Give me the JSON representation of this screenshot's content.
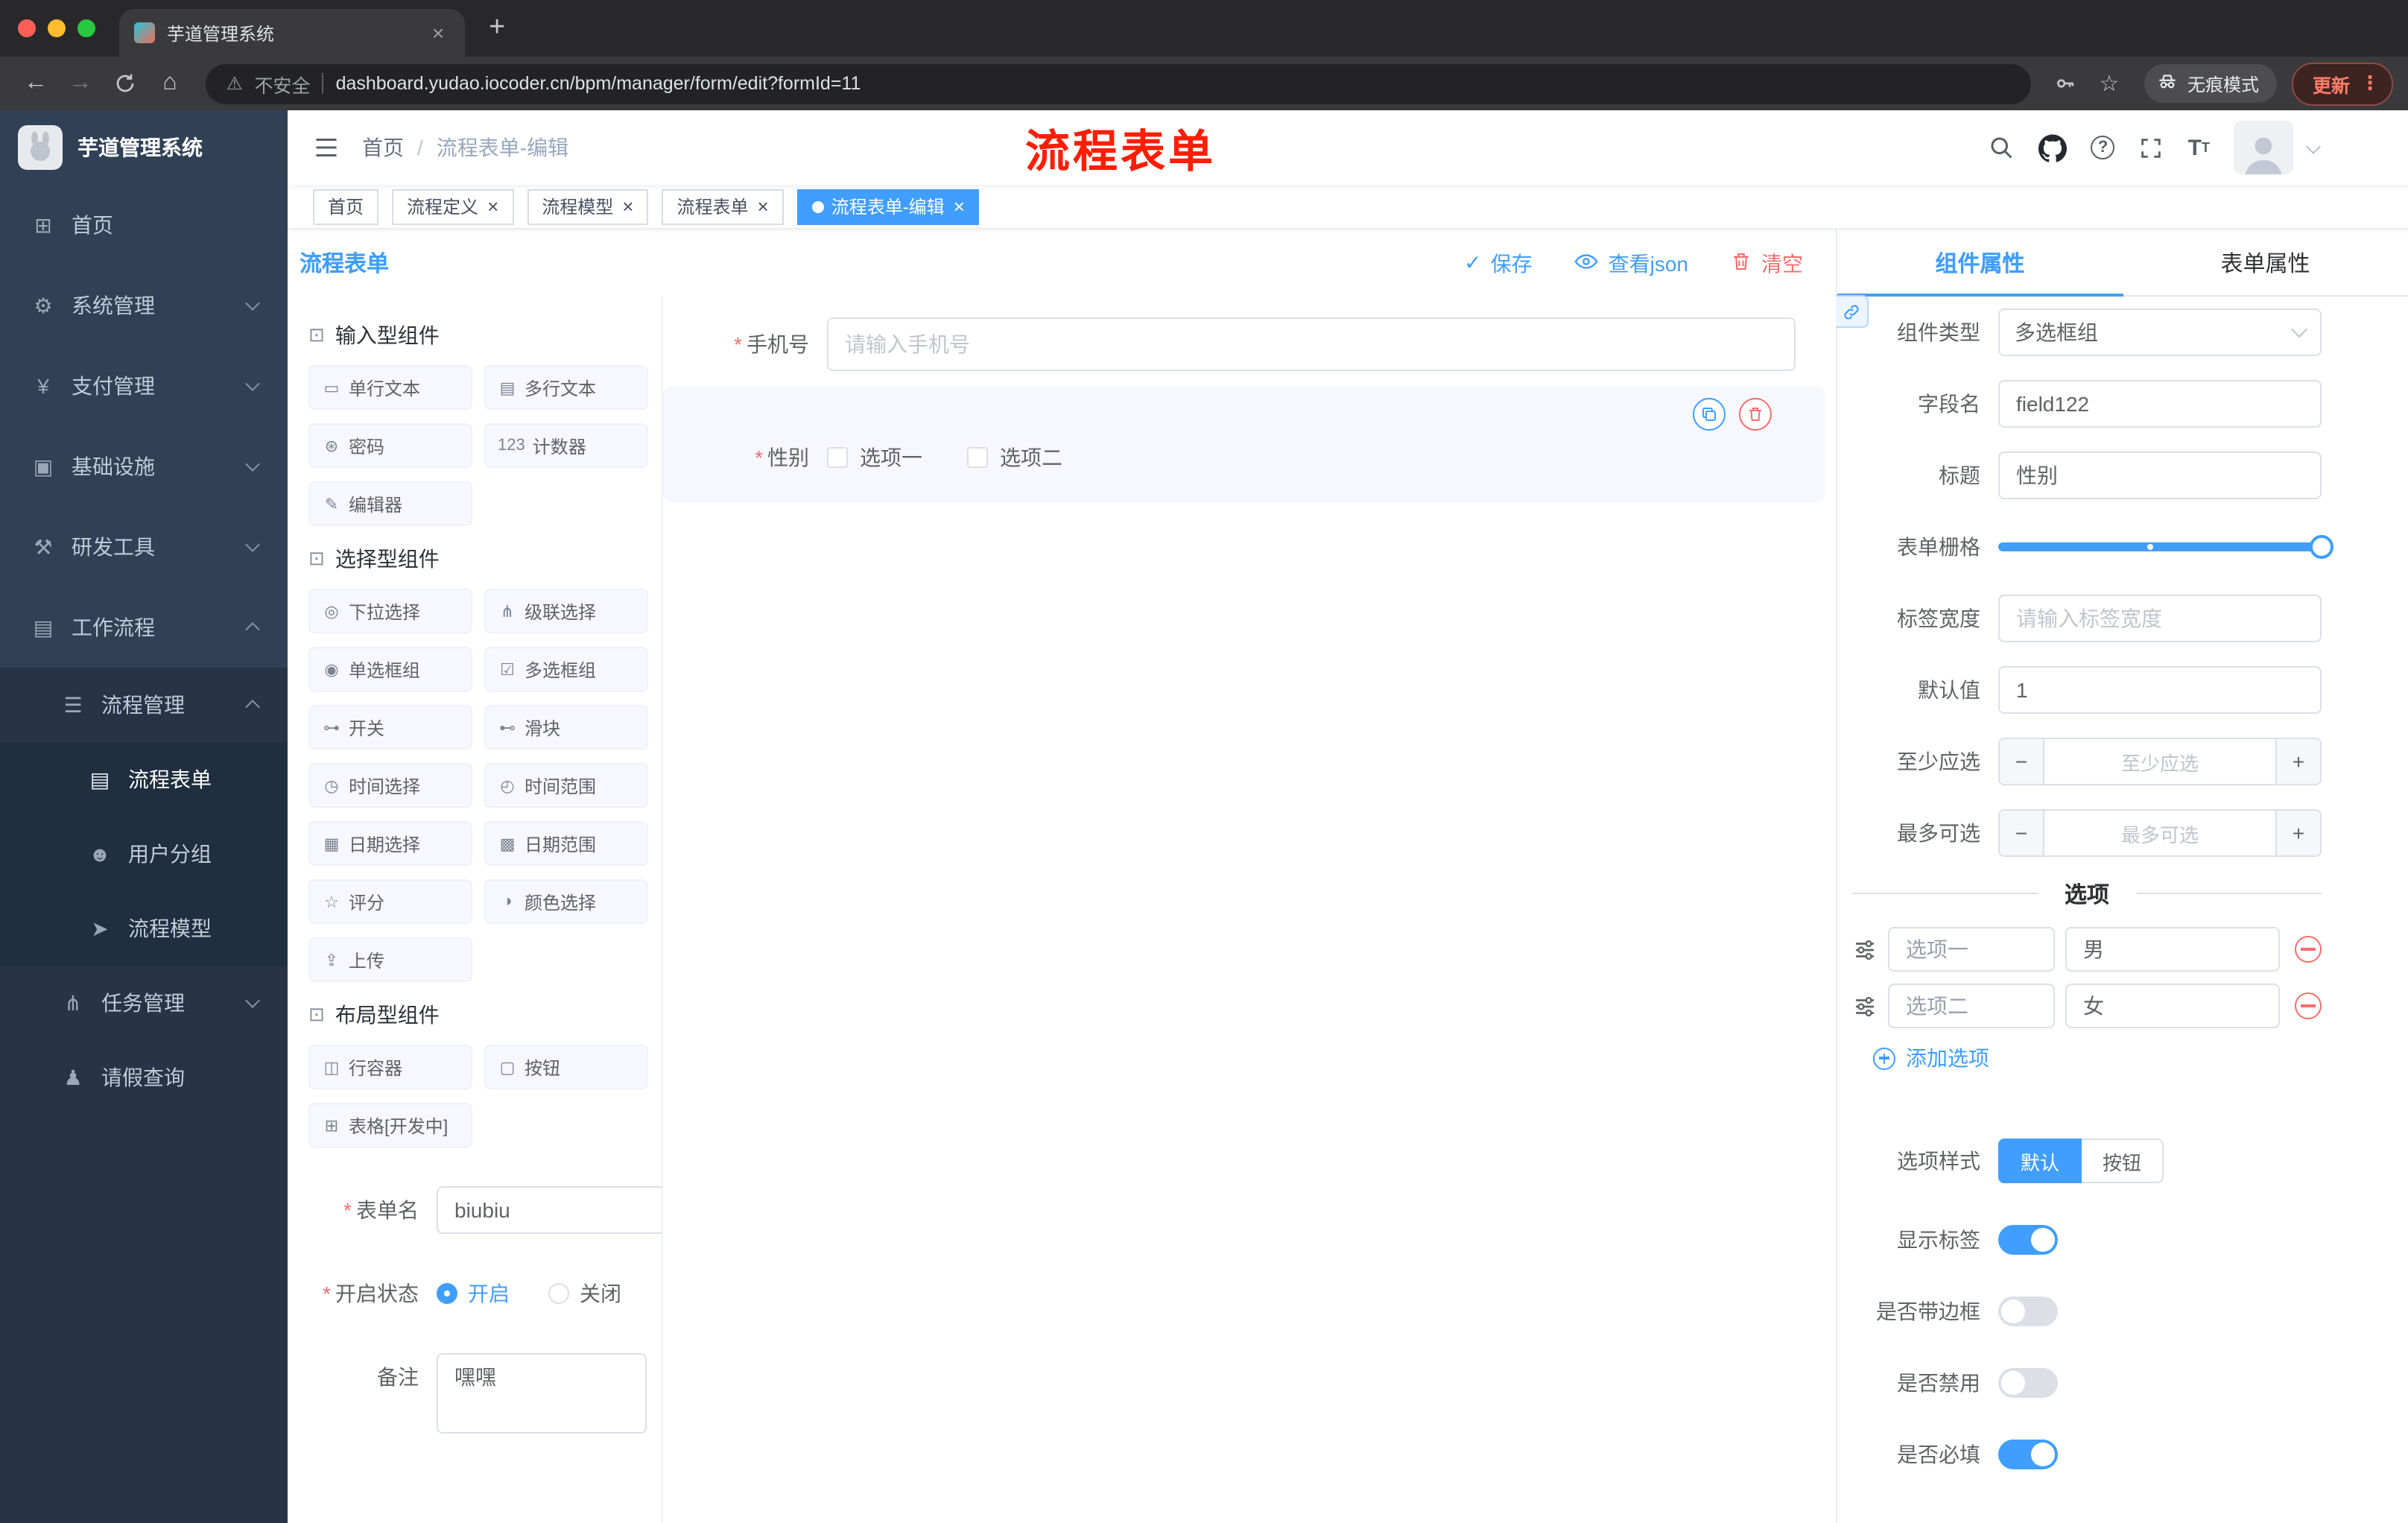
{
  "colors": {
    "accent": "#409eff",
    "danger": "#f56c6c",
    "annotation": "#ff1e00",
    "sidebar_bg": "#304156"
  },
  "ui": {
    "required_mark": "*",
    "close_glyph": "×",
    "plus_glyph": "+",
    "back_glyph": "←",
    "forward_glyph": "→",
    "home_glyph": "⌂",
    "warning_glyph": "⚠",
    "star_glyph": "☆",
    "kebab_glyph": "⋮",
    "check_glyph": "✓",
    "question_glyph": "?",
    "font_size_glyph": "T",
    "minus_glyph": "−"
  },
  "annotation": {
    "text": "流程表单"
  },
  "browser": {
    "tab_title": "芋道管理系统",
    "security_label": "不安全",
    "url": "dashboard.yudao.iocoder.cn/bpm/manager/form/edit?formId=11",
    "incognito_label": "无痕模式",
    "update_label": "更新"
  },
  "sidebar": {
    "logo_title": "芋道管理系统",
    "items": [
      {
        "label": "首页",
        "glyph": "⊞"
      },
      {
        "label": "系统管理",
        "glyph": "⚙"
      },
      {
        "label": "支付管理",
        "glyph": "¥"
      },
      {
        "label": "基础设施",
        "glyph": "▣"
      },
      {
        "label": "研发工具",
        "glyph": "⚒"
      },
      {
        "label": "工作流程",
        "glyph": "▤"
      }
    ],
    "workflow": {
      "process_mgmt": {
        "label": "流程管理",
        "glyph": "☰"
      },
      "children": [
        {
          "label": "流程表单",
          "glyph": "▤"
        },
        {
          "label": "用户分组",
          "glyph": "☻"
        },
        {
          "label": "流程模型",
          "glyph": "➤"
        }
      ],
      "task_mgmt": {
        "label": "任务管理",
        "glyph": "⋔"
      },
      "leave_query": {
        "label": "请假查询",
        "glyph": "♟"
      }
    }
  },
  "navbar": {
    "breadcrumb_home": "首页",
    "breadcrumb_sep": "/",
    "breadcrumb_current": "流程表单-编辑"
  },
  "tags": [
    {
      "label": "首页"
    },
    {
      "label": "流程定义"
    },
    {
      "label": "流程模型"
    },
    {
      "label": "流程表单"
    },
    {
      "label": "流程表单-编辑"
    }
  ],
  "designer": {
    "title": "流程表单",
    "save": "保存",
    "view_json": "查看json",
    "clear": "清空",
    "groups": [
      {
        "title": "输入型组件",
        "glyph": "⊡",
        "items": [
          {
            "label": "单行文本",
            "glyph": "▭"
          },
          {
            "label": "多行文本",
            "glyph": "▤"
          },
          {
            "label": "密码",
            "glyph": "⊛"
          },
          {
            "label": "计数器",
            "glyph": "123"
          },
          {
            "label": "编辑器",
            "glyph": "✎"
          }
        ]
      },
      {
        "title": "选择型组件",
        "glyph": "⊡",
        "items": [
          {
            "label": "下拉选择",
            "glyph": "◎"
          },
          {
            "label": "级联选择",
            "glyph": "⋔"
          },
          {
            "label": "单选框组",
            "glyph": "◉"
          },
          {
            "label": "多选框组",
            "glyph": "☑"
          },
          {
            "label": "开关",
            "glyph": "⊶"
          },
          {
            "label": "滑块",
            "glyph": "⊷"
          },
          {
            "label": "时间选择",
            "glyph": "◷"
          },
          {
            "label": "时间范围",
            "glyph": "◴"
          },
          {
            "label": "日期选择",
            "glyph": "▦"
          },
          {
            "label": "日期范围",
            "glyph": "▩"
          },
          {
            "label": "评分",
            "glyph": "☆"
          },
          {
            "label": "颜色选择",
            "glyph": "◑"
          },
          {
            "label": "上传",
            "glyph": "⇪"
          }
        ]
      },
      {
        "title": "布局型组件",
        "glyph": "⊡",
        "items": [
          {
            "label": "行容器",
            "glyph": "◫"
          },
          {
            "label": "按钮",
            "glyph": "▢"
          },
          {
            "label": "表格[开发中]",
            "glyph": "⊞"
          }
        ]
      }
    ],
    "meta": {
      "name_label": "表单名",
      "name_value": "biubiu",
      "status_label": "开启状态",
      "status_on": "开启",
      "status_off": "关闭",
      "remark_label": "备注",
      "remark_value": "嘿嘿"
    }
  },
  "canvas": {
    "phone_label": "手机号",
    "phone_placeholder": "请输入手机号",
    "gender_label": "性别",
    "gender_opt1": "选项一",
    "gender_opt2": "选项二"
  },
  "props": {
    "tab_component": "组件属性",
    "tab_form": "表单属性",
    "component_type_label": "组件类型",
    "component_type_value": "多选框组",
    "field_name_label": "字段名",
    "field_name_value": "field122",
    "title_label": "标题",
    "title_value": "性别",
    "grid_label": "表单栅格",
    "label_width_label": "标签宽度",
    "label_width_placeholder": "请输入标签宽度",
    "default_label": "默认值",
    "default_value": "1",
    "min_label": "至少应选",
    "min_placeholder": "至少应选",
    "max_label": "最多可选",
    "max_placeholder": "最多可选",
    "options_title": "选项",
    "options": [
      {
        "label": "选项一",
        "value": "男"
      },
      {
        "label": "选项二",
        "value": "女"
      }
    ],
    "add_option": "添加选项",
    "style_label": "选项样式",
    "style_default": "默认",
    "style_button": "按钮",
    "show_label": "显示标签",
    "border_label": "是否带边框",
    "disabled_label": "是否禁用",
    "required_label": "是否必填",
    "switches": {
      "show_label": true,
      "border": false,
      "disabled": false,
      "required": true
    }
  }
}
